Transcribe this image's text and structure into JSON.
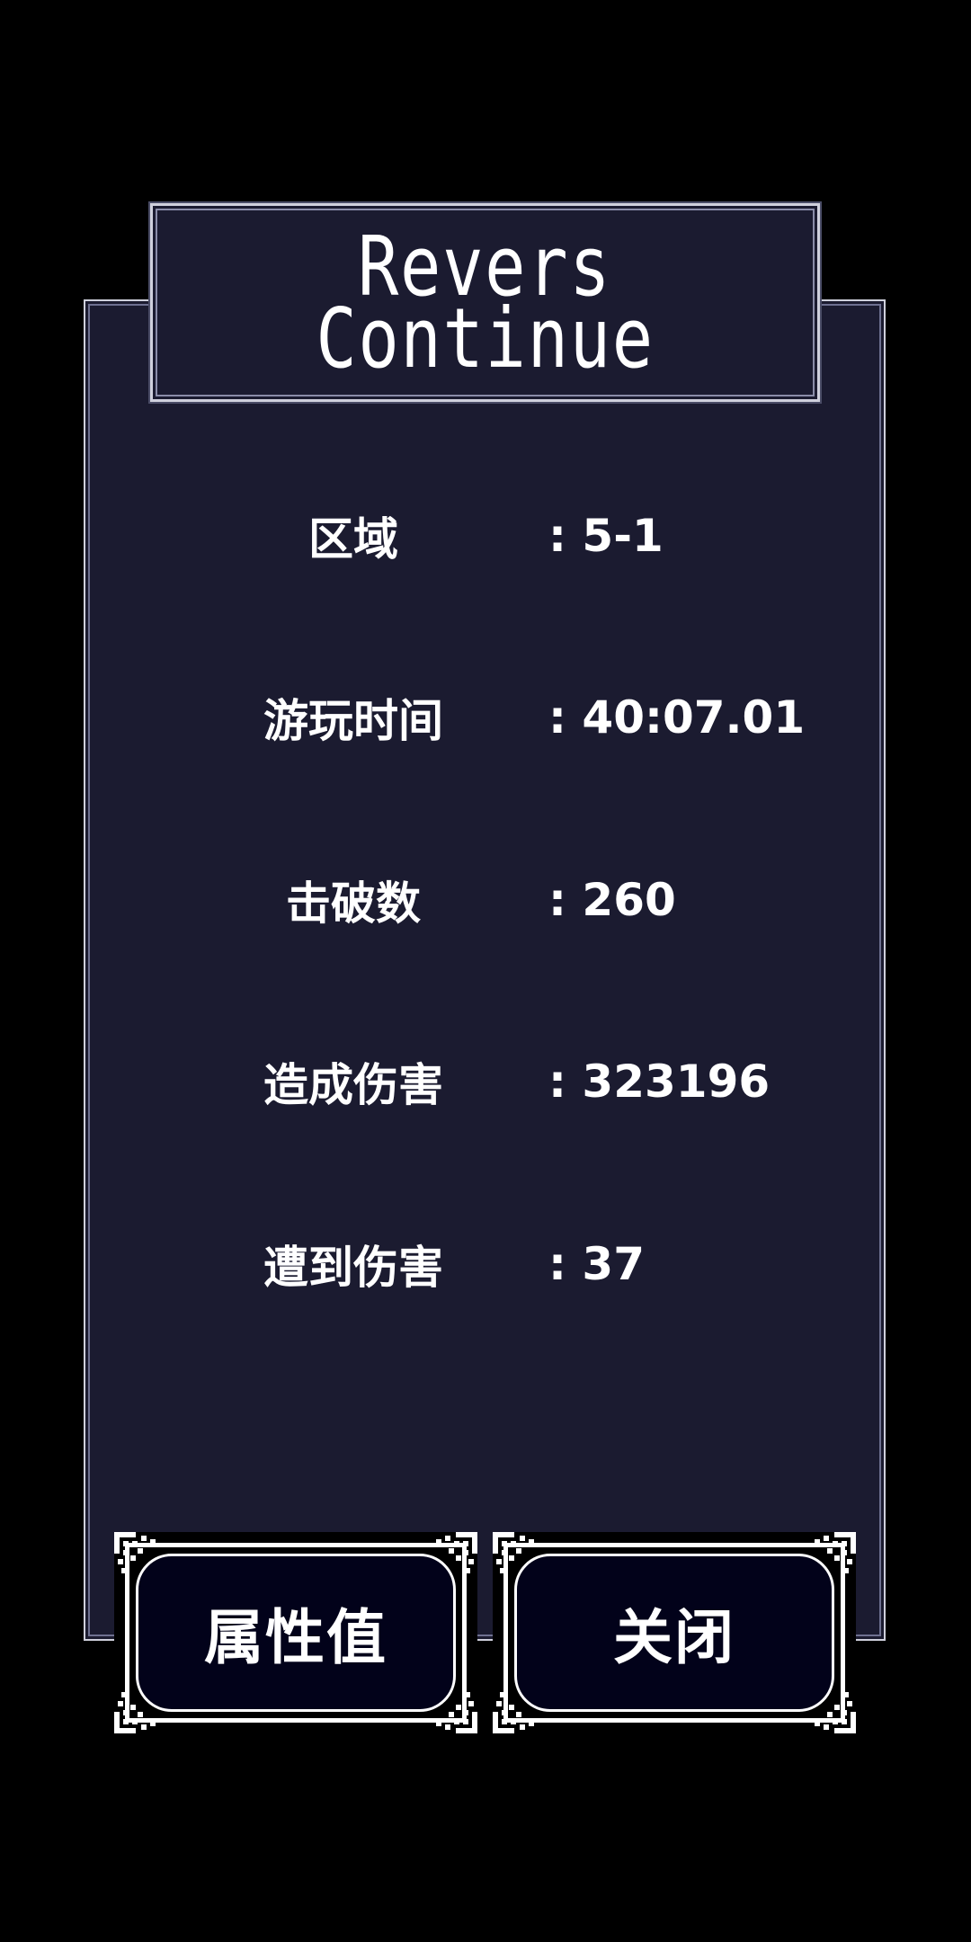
{
  "title": {
    "line1": "Revers",
    "line2": "Continue"
  },
  "stats": [
    {
      "label": "区域",
      "value": ": 5-1"
    },
    {
      "label": "游玩时间",
      "value": ": 40:07.01"
    },
    {
      "label": "击破数",
      "value": ": 260"
    },
    {
      "label": "造成伤害",
      "value": ": 323196"
    },
    {
      "label": "遭到伤害",
      "value": ": 37"
    }
  ],
  "buttons": {
    "attributes_label": "属性值",
    "close_label": "关闭"
  },
  "colors": {
    "background": "#000000",
    "panel": "#1b1b30",
    "border": "#cfd0dc",
    "text": "#ffffff",
    "button_fill": "#02021a"
  }
}
